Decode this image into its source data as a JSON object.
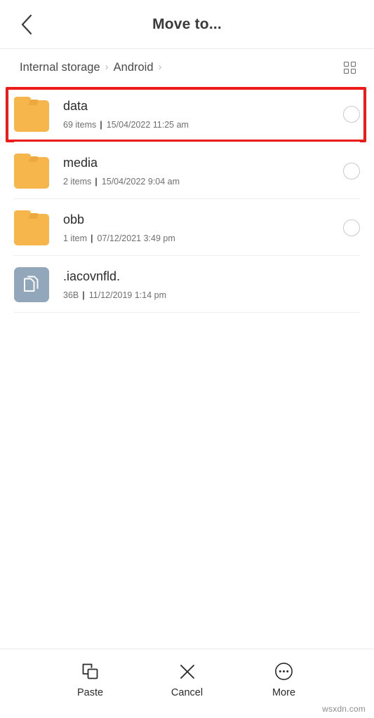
{
  "header": {
    "title": "Move to...",
    "back_icon": "chevron-left-icon"
  },
  "breadcrumb": {
    "separator": "›",
    "trailing_separator": "›",
    "items": [
      {
        "label": "Internal storage"
      },
      {
        "label": "Android"
      }
    ],
    "view_toggle_icon": "grid-view-icon"
  },
  "files": {
    "rows": [
      {
        "name": "data",
        "meta_count": "69 items",
        "meta_sep": "|",
        "meta_date": "15/04/2022 11:25 am",
        "icon": "folder-icon",
        "type": "folder",
        "selectable": true,
        "highlighted": true
      },
      {
        "name": "media",
        "meta_count": "2 items",
        "meta_sep": "|",
        "meta_date": "15/04/2022 9:04 am",
        "icon": "folder-icon",
        "type": "folder",
        "selectable": true,
        "highlighted": false
      },
      {
        "name": "obb",
        "meta_count": "1 item",
        "meta_sep": "|",
        "meta_date": "07/12/2021 3:49 pm",
        "icon": "folder-icon",
        "type": "folder",
        "selectable": true,
        "highlighted": false
      },
      {
        "name": ".iacovnfld.",
        "meta_count": "36B",
        "meta_sep": "|",
        "meta_date": "11/12/2019 1:14 pm",
        "icon": "document-file-icon",
        "type": "file",
        "selectable": false,
        "highlighted": false
      }
    ]
  },
  "bottom_bar": {
    "actions": [
      {
        "label": "Paste",
        "icon": "paste-icon"
      },
      {
        "label": "Cancel",
        "icon": "close-x-icon"
      },
      {
        "label": "More",
        "icon": "more-dots-icon"
      }
    ]
  },
  "watermark": {
    "text": "wsxdn.com"
  },
  "colors": {
    "folder": "#f7b64c",
    "file_tile": "#93a7bb",
    "annotation": "#ee1b1b",
    "text_primary": "#2b2b2b",
    "text_secondary": "#6f6f6f",
    "divider": "#ededed"
  }
}
